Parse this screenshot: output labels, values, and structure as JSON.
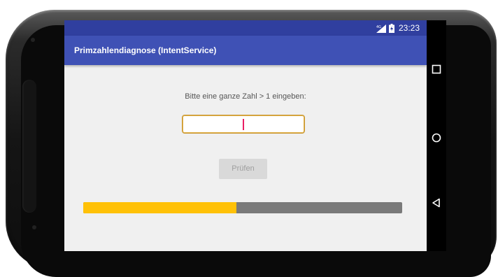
{
  "status_bar": {
    "time": "23:23",
    "network": "4G"
  },
  "app_bar": {
    "title": "Primzahlendiagnose (IntentService)"
  },
  "main": {
    "prompt": "Bitte eine ganze Zahl > 1 eingeben:",
    "input_value": "",
    "button_label": "Prüfen",
    "progress": 0.48
  },
  "nav": {
    "icons": [
      "square-recents-icon",
      "circle-home-icon",
      "triangle-back-icon"
    ]
  },
  "colors": {
    "status_bar": "#303f9f",
    "app_bar": "#3f51b5",
    "progress_fill": "#ffc107",
    "progress_track": "#7a7a7a",
    "cursor": "#e91e63"
  }
}
